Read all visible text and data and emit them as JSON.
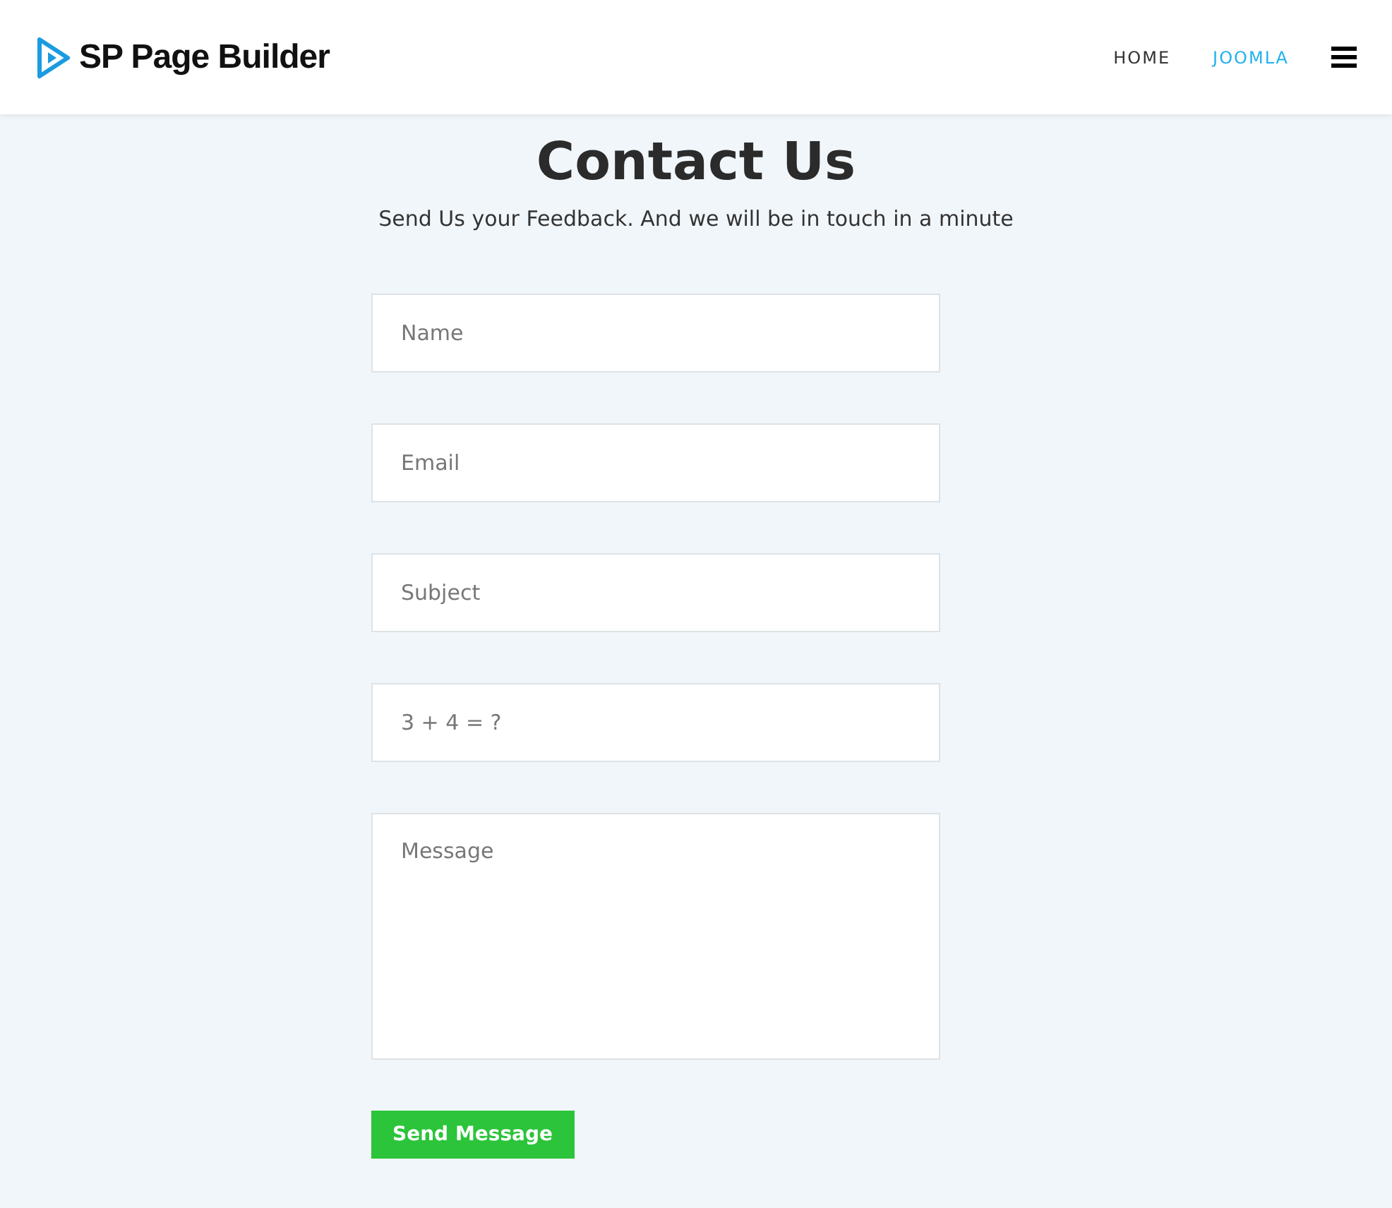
{
  "header": {
    "logo": "SP Page Builder",
    "nav": [
      {
        "label": "HOME",
        "selected": false
      },
      {
        "label": "JOOMLA",
        "selected": true
      }
    ]
  },
  "title": "Contact Us",
  "subtitle": "Send Us your Feedback. And we will be in touch in a minute",
  "fields": [
    {
      "kind": "input",
      "placeholder": "Name"
    },
    {
      "kind": "input",
      "placeholder": "Email"
    },
    {
      "kind": "input",
      "placeholder": "Subject"
    },
    {
      "kind": "input",
      "placeholder": "3 + 4 = ?"
    },
    {
      "kind": "textarea",
      "placeholder": "Message"
    }
  ],
  "button": "Send Message"
}
